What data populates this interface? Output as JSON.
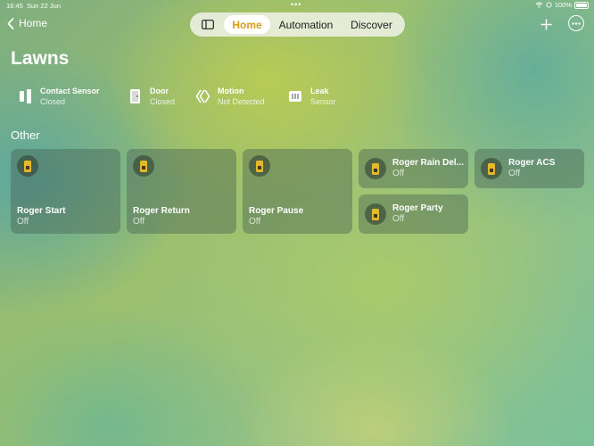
{
  "status_bar": {
    "time": "16:45",
    "date": "Sun 22 Jun",
    "battery": "100%"
  },
  "nav": {
    "back_label": "Home",
    "tabs": [
      {
        "label": "Home",
        "active": true
      },
      {
        "label": "Automation",
        "active": false
      },
      {
        "label": "Discover",
        "active": false
      }
    ]
  },
  "page": {
    "title": "Lawns"
  },
  "sensors": [
    {
      "name": "Contact Sensor",
      "status": "Closed",
      "icon": "contact-sensor-icon"
    },
    {
      "name": "Door",
      "status": "Closed",
      "icon": "door-icon"
    },
    {
      "name": "Motion",
      "status": "Not Detected",
      "icon": "motion-icon"
    },
    {
      "name": "Leak",
      "status": "Sensor",
      "icon": "leak-icon"
    }
  ],
  "section": {
    "title": "Other"
  },
  "accessories": [
    {
      "name": "Roger Start",
      "status": "Off",
      "icon": "switch-icon"
    },
    {
      "name": "Roger Return",
      "status": "Off",
      "icon": "switch-icon"
    },
    {
      "name": "Roger Pause",
      "status": "Off",
      "icon": "switch-icon"
    },
    {
      "name": "Roger Rain Del...",
      "status": "Off",
      "icon": "switch-icon"
    },
    {
      "name": "Roger ACS",
      "status": "Off",
      "icon": "switch-icon"
    },
    {
      "name": "Roger Party",
      "status": "Off",
      "icon": "switch-icon"
    }
  ],
  "colors": {
    "accent": "#d99b1e",
    "switch_on": "#e5b82b"
  }
}
